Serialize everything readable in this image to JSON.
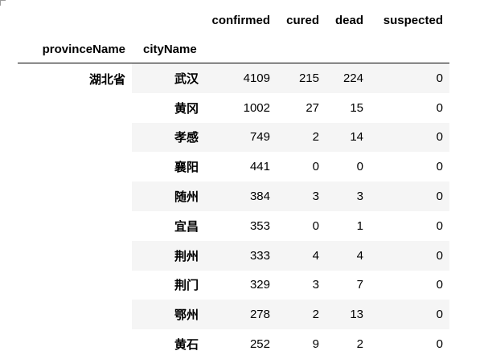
{
  "table": {
    "columns": [
      "confirmed",
      "cured",
      "dead",
      "suspected"
    ],
    "index_names": [
      "provinceName",
      "cityName"
    ],
    "province": "湖北省",
    "rows": [
      {
        "city": "武汉",
        "confirmed": "4109",
        "cured": "215",
        "dead": "224",
        "suspected": "0"
      },
      {
        "city": "黄冈",
        "confirmed": "1002",
        "cured": "27",
        "dead": "15",
        "suspected": "0"
      },
      {
        "city": "孝感",
        "confirmed": "749",
        "cured": "2",
        "dead": "14",
        "suspected": "0"
      },
      {
        "city": "襄阳",
        "confirmed": "441",
        "cured": "0",
        "dead": "0",
        "suspected": "0"
      },
      {
        "city": "随州",
        "confirmed": "384",
        "cured": "3",
        "dead": "3",
        "suspected": "0"
      },
      {
        "city": "宜昌",
        "confirmed": "353",
        "cured": "0",
        "dead": "1",
        "suspected": "0"
      },
      {
        "city": "荆州",
        "confirmed": "333",
        "cured": "4",
        "dead": "4",
        "suspected": "0"
      },
      {
        "city": "荆门",
        "confirmed": "329",
        "cured": "3",
        "dead": "7",
        "suspected": "0"
      },
      {
        "city": "鄂州",
        "confirmed": "278",
        "cured": "2",
        "dead": "13",
        "suspected": "0"
      },
      {
        "city": "黄石",
        "confirmed": "252",
        "cured": "9",
        "dead": "2",
        "suspected": "0"
      }
    ]
  }
}
